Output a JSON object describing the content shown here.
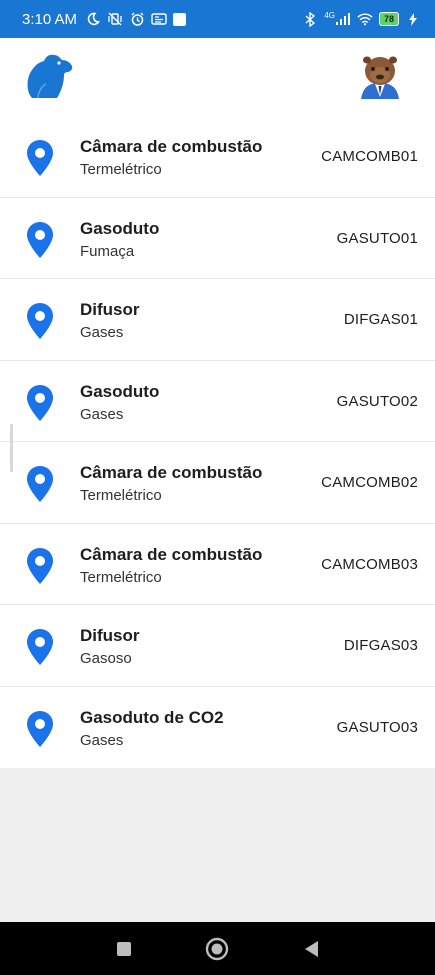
{
  "status_bar": {
    "time": "3:10 AM",
    "network": "4G",
    "battery": "78"
  },
  "header": {
    "logo_icon": "capybara-logo-icon",
    "avatar_icon": "capybara-avatar-icon"
  },
  "items": [
    {
      "title": "Câmara de combustão",
      "subtitle": "Termelétrico",
      "code": "CAMCOMB01"
    },
    {
      "title": "Gasoduto",
      "subtitle": "Fumaça",
      "code": "GASUTO01"
    },
    {
      "title": "Difusor",
      "subtitle": "Gases",
      "code": "DIFGAS01"
    },
    {
      "title": "Gasoduto",
      "subtitle": "Gases",
      "code": "GASUTO02"
    },
    {
      "title": "Câmara de combustão",
      "subtitle": "Termelétrico",
      "code": "CAMCOMB02"
    },
    {
      "title": "Câmara de combustão",
      "subtitle": "Termelétrico",
      "code": "CAMCOMB03"
    },
    {
      "title": "Difusor",
      "subtitle": "Gasoso",
      "code": "DIFGAS03"
    },
    {
      "title": "Gasoduto de CO2",
      "subtitle": "Gases",
      "code": "GASUTO03"
    }
  ],
  "colors": {
    "primary": "#1976d2",
    "pin": "#1a73e8",
    "background": "#efefef"
  },
  "nav": {
    "recent": "square-icon",
    "home": "circle-home-icon",
    "back": "triangle-back-icon"
  }
}
